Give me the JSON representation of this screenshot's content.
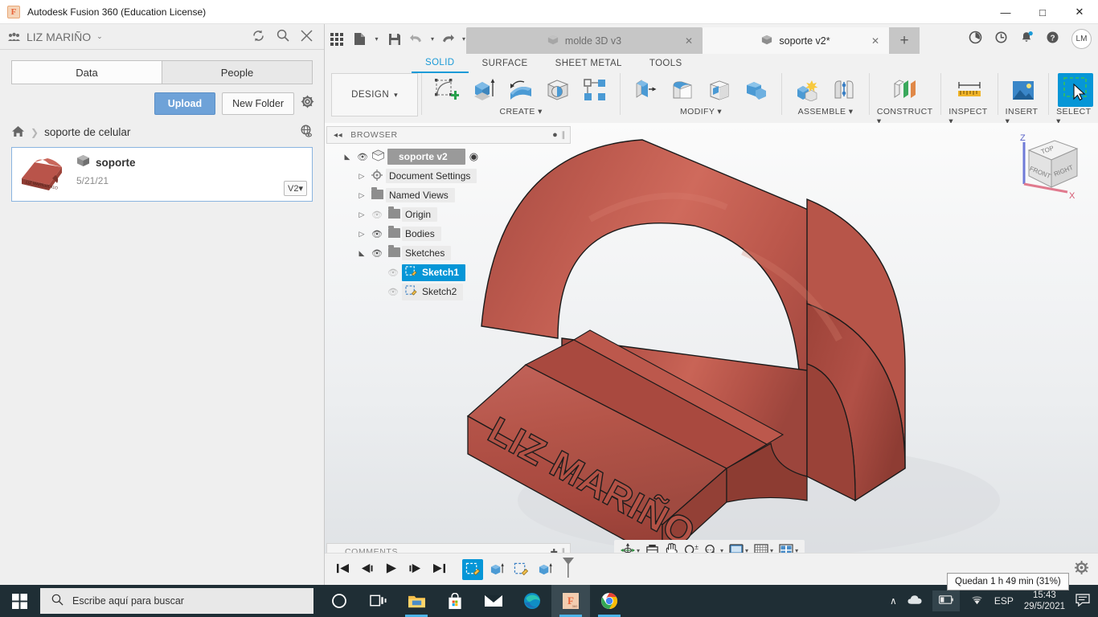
{
  "window": {
    "title": "Autodesk Fusion 360 (Education License)",
    "logo_text": "F",
    "minimize": "—",
    "maximize": "□",
    "close": "✕"
  },
  "data_panel": {
    "project_name": "LIZ MARIÑO",
    "project_caret": "⌄",
    "refresh_icon": "refresh-icon",
    "search_icon": "search-icon",
    "close_icon": "close-icon",
    "tabs": [
      {
        "label": "Data",
        "active": true
      },
      {
        "label": "People",
        "active": false
      }
    ],
    "upload_label": "Upload",
    "new_folder_label": "New Folder",
    "settings_icon": "gear-icon",
    "breadcrumb": {
      "home_icon": "home-icon",
      "separator": "❯",
      "path": "soporte de celular",
      "globe_icon": "globe-icon"
    },
    "file": {
      "name": "soporte",
      "date": "5/21/21",
      "version": "V2",
      "version_caret": "▾"
    }
  },
  "quick_access": {
    "grid_icon": "app-grid-icon",
    "new_icon": "new-document-icon",
    "save_icon": "save-icon",
    "undo_icon": "undo-icon",
    "redo_icon": "redo-icon",
    "caret": "▾",
    "add_tab": "+",
    "right_icons": [
      {
        "name": "job-status-icon",
        "glyph": "◔"
      },
      {
        "name": "recent-icon",
        "glyph": "◴"
      },
      {
        "name": "notifications-bell-icon",
        "glyph": "🔔"
      },
      {
        "name": "help-icon",
        "glyph": "?"
      }
    ],
    "avatar_initials": "LM"
  },
  "document_tabs": [
    {
      "label": "molde 3D v3",
      "active": false,
      "close": "✕"
    },
    {
      "label": "soporte v2*",
      "active": true,
      "close": "✕"
    }
  ],
  "ribbon": {
    "tabs": [
      {
        "label": "SOLID",
        "active": true
      },
      {
        "label": "SURFACE",
        "active": false
      },
      {
        "label": "SHEET METAL",
        "active": false
      },
      {
        "label": "TOOLS",
        "active": false
      }
    ],
    "workspace": "DESIGN",
    "workspace_caret": "▾",
    "groups": [
      {
        "label": "CREATE",
        "caret": "▾",
        "tools": [
          "create-sketch-icon",
          "extrude-icon",
          "revolve-icon",
          "sphere-icon",
          "pattern-icon"
        ]
      },
      {
        "label": "MODIFY",
        "caret": "▾",
        "tools": [
          "press-pull-icon",
          "fillet-icon",
          "shell-icon",
          "combine-icon"
        ]
      },
      {
        "label": "ASSEMBLE",
        "caret": "▾",
        "tools": [
          "new-component-icon",
          "joint-icon"
        ]
      },
      {
        "label": "CONSTRUCT",
        "caret": "▾",
        "tools": [
          "offset-plane-icon"
        ]
      },
      {
        "label": "INSPECT",
        "caret": "▾",
        "tools": [
          "measure-icon"
        ]
      },
      {
        "label": "INSERT",
        "caret": "▾",
        "tools": [
          "insert-image-icon"
        ]
      },
      {
        "label": "SELECT",
        "caret": "▾",
        "tools": [
          "select-window-icon"
        ]
      }
    ]
  },
  "browser": {
    "title": "BROWSER",
    "collapse_icon": "collapse-arrows-icon",
    "dot_icon": "minimize-dot-icon",
    "nodes": [
      {
        "label": "soporte v2",
        "level": 0,
        "expanded": true,
        "eye": "on",
        "selected": false,
        "root": true,
        "radio": "◉"
      },
      {
        "label": "Document Settings",
        "level": 1,
        "expanded": false,
        "eye": "none",
        "icon": "gear-icon"
      },
      {
        "label": "Named Views",
        "level": 1,
        "expanded": false,
        "eye": "none",
        "icon": "folder-icon"
      },
      {
        "label": "Origin",
        "level": 1,
        "expanded": false,
        "eye": "off",
        "icon": "folder-icon"
      },
      {
        "label": "Bodies",
        "level": 1,
        "expanded": false,
        "eye": "on",
        "icon": "folder-icon"
      },
      {
        "label": "Sketches",
        "level": 1,
        "expanded": true,
        "eye": "on",
        "icon": "folder-icon"
      },
      {
        "label": "Sketch1",
        "level": 2,
        "expanded": null,
        "eye": "off",
        "icon": "sketch-icon",
        "selected": true
      },
      {
        "label": "Sketch2",
        "level": 2,
        "expanded": null,
        "eye": "off",
        "icon": "sketch-icon",
        "selected": false
      }
    ]
  },
  "viewcube": {
    "faces": {
      "top": "TOP",
      "front": "FRONT",
      "right": "RIGHT"
    },
    "axis_z": "Z",
    "axis_x": "X"
  },
  "model": {
    "engraved_text": "LIZ MARIÑO",
    "body_color": "#b9544a",
    "shade_dark": "#9d4339",
    "shade_light": "#c9685c"
  },
  "nav_bar": {
    "tools": [
      {
        "name": "orbit-icon",
        "caret": "▾"
      },
      {
        "name": "look-at-icon",
        "caret": ""
      },
      {
        "name": "pan-icon",
        "caret": ""
      },
      {
        "name": "zoom-icon",
        "caret": ""
      },
      {
        "name": "fit-icon",
        "caret": "▾"
      },
      {
        "name": "display-settings-icon",
        "caret": "▾"
      },
      {
        "name": "grid-snaps-icon",
        "caret": "▾"
      },
      {
        "name": "viewports-icon",
        "caret": "▾"
      }
    ]
  },
  "comments": {
    "label": "COMMENTS",
    "add_icon": "add-comment-icon"
  },
  "timeline": {
    "controls": [
      {
        "name": "go-to-beginning-icon",
        "glyph": "⏮"
      },
      {
        "name": "step-back-icon",
        "glyph": "◀❘"
      },
      {
        "name": "play-icon",
        "glyph": "▶"
      },
      {
        "name": "step-forward-icon",
        "glyph": "❘▶"
      },
      {
        "name": "go-to-end-icon",
        "glyph": "⏭"
      }
    ],
    "features": [
      {
        "name": "sketch1-feature",
        "icon": "sketch-icon",
        "selected": true
      },
      {
        "name": "extrude1-feature",
        "icon": "extrude-icon",
        "selected": false
      },
      {
        "name": "sketch2-feature",
        "icon": "sketch-icon",
        "selected": false
      },
      {
        "name": "extrude2-feature",
        "icon": "extrude-icon",
        "selected": false
      }
    ],
    "settings_icon": "gear-icon"
  },
  "tooltip": {
    "text": "Quedan 1 h 49 min (31%)"
  },
  "taskbar": {
    "start_icon": "windows-start-icon",
    "search_placeholder": "Escribe aquí para buscar",
    "search_icon": "search-icon",
    "apps": [
      {
        "name": "cortana-icon",
        "active": false,
        "running": false
      },
      {
        "name": "task-view-icon",
        "active": false,
        "running": false
      },
      {
        "name": "file-explorer-icon",
        "active": false,
        "running": true
      },
      {
        "name": "microsoft-store-icon",
        "active": false,
        "running": false
      },
      {
        "name": "mail-icon",
        "active": false,
        "running": false
      },
      {
        "name": "microsoft-edge-icon",
        "active": false,
        "running": true
      },
      {
        "name": "fusion-360-icon",
        "active": true,
        "running": true
      },
      {
        "name": "google-chrome-icon",
        "active": false,
        "running": true
      }
    ],
    "tray": {
      "chevron": "∧",
      "cloud_icon": "onedrive-icon",
      "battery_icon": "battery-icon",
      "wifi_icon": "wifi-icon",
      "language": "ESP",
      "time": "15:43",
      "date": "29/5/2021",
      "action_center_icon": "action-center-icon"
    }
  }
}
